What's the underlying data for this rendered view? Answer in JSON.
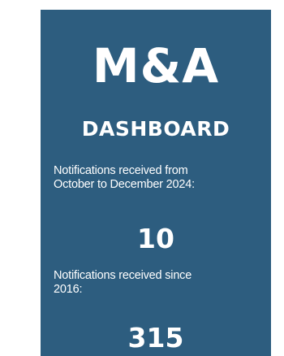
{
  "card": {
    "title": "M&A",
    "subtitle": "DASHBOARD",
    "colors": {
      "background": "#2d5d7f",
      "text": "#ffffff"
    },
    "stats": [
      {
        "label": "Notifications received from\nOctober to December 2024:",
        "value": "10"
      },
      {
        "label": "Notifications received since\n2016:",
        "value": "315"
      }
    ]
  }
}
